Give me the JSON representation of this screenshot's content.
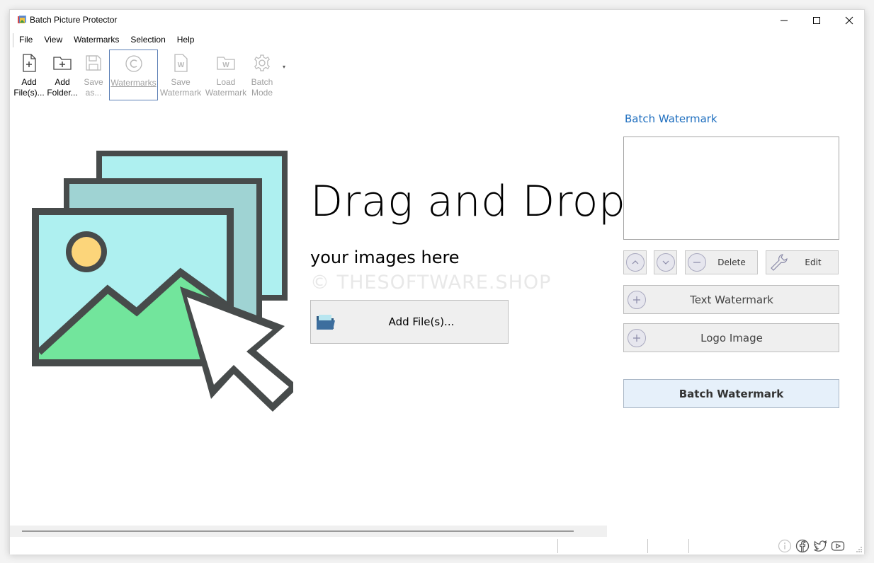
{
  "window": {
    "title": "Batch Picture Protector"
  },
  "menu": {
    "items": [
      "File",
      "View",
      "Watermarks",
      "Selection",
      "Help"
    ]
  },
  "toolbar": {
    "buttons": [
      {
        "line1": "Add",
        "line2": "File(s)...",
        "icon": "add-file-icon"
      },
      {
        "line1": "Add",
        "line2": "Folder...",
        "icon": "add-folder-icon"
      },
      {
        "line1": "Save",
        "line2": "as...",
        "icon": "save-icon"
      },
      {
        "line1": "Watermarks",
        "line2": "",
        "icon": "copyright-icon"
      },
      {
        "line1": "Save",
        "line2": "Watermark",
        "icon": "save-watermark-icon"
      },
      {
        "line1": "Load",
        "line2": "Watermark",
        "icon": "load-watermark-icon"
      },
      {
        "line1": "Batch",
        "line2": "Mode",
        "icon": "gear-icon"
      }
    ]
  },
  "main": {
    "drag_title": "Drag and Drop",
    "drag_subtitle": "your images here",
    "watermark_overlay": "© THESOFTWARE.SHOP",
    "add_files_label": "Add File(s)..."
  },
  "panel": {
    "title": "Batch Watermark",
    "delete_label": "Delete",
    "edit_label": "Edit",
    "text_watermark_label": "Text Watermark",
    "logo_image_label": "Logo Image",
    "batch_button_label": "Batch Watermark"
  },
  "colors": {
    "accent_link": "#1f6fbf",
    "image_back": "#aef0f0",
    "image_mid": "#9fd3d3",
    "sun": "#fcd57a",
    "mountain": "#72e59c",
    "frame": "#474b4b"
  }
}
